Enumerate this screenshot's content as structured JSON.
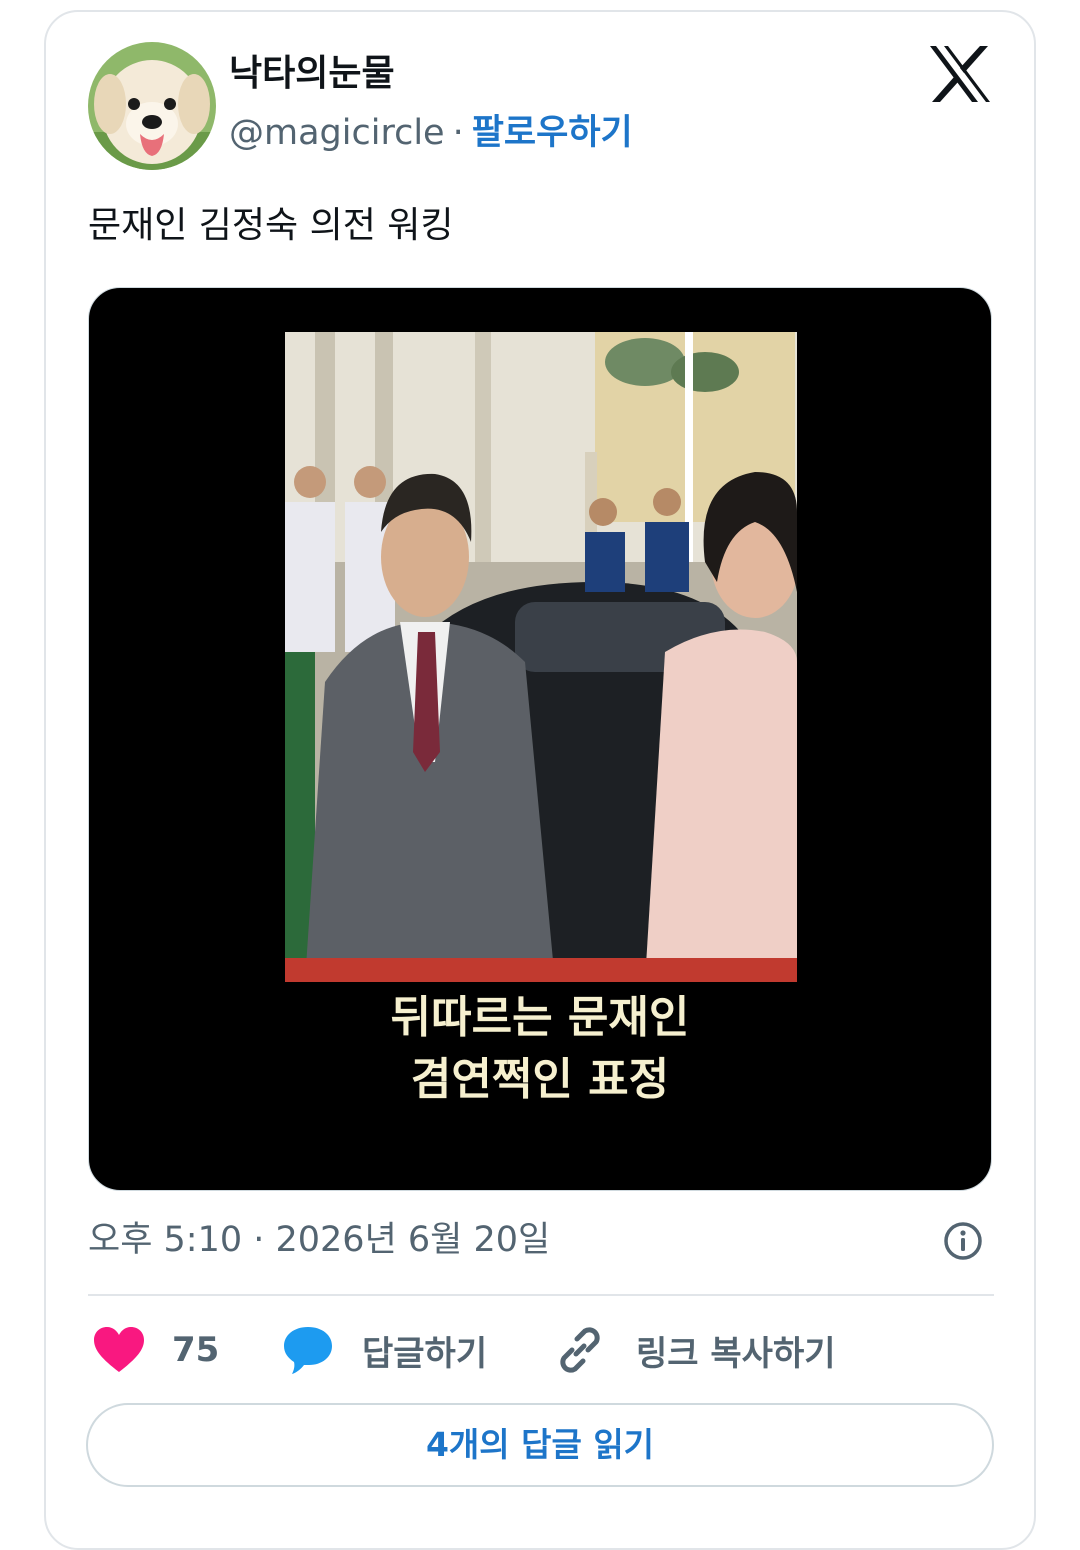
{
  "user": {
    "display_name": "낙타의눈물",
    "handle": "@magicircle",
    "separator": "·",
    "follow_label": "팔로우하기",
    "avatar_icon": "puppy-avatar"
  },
  "brand": {
    "logo": "x-logo-icon",
    "color": "#0f1419"
  },
  "tweet": {
    "text": "문재인 김정숙 의전 워킹",
    "media": {
      "caption_line1": "뒤따르는 문재인",
      "caption_line2": "겸연쩍인 표정"
    },
    "timestamp": "오후 5:10 · 2026년 6월 20일"
  },
  "actions": {
    "like_count": "75",
    "reply_label": "답글하기",
    "copy_link_label": "링크 복사하기"
  },
  "read_replies_label": "4개의 답글 읽기",
  "colors": {
    "accent": "#1d75c9",
    "like": "#f91880",
    "reply": "#1d9bf0",
    "muted": "#536471"
  }
}
